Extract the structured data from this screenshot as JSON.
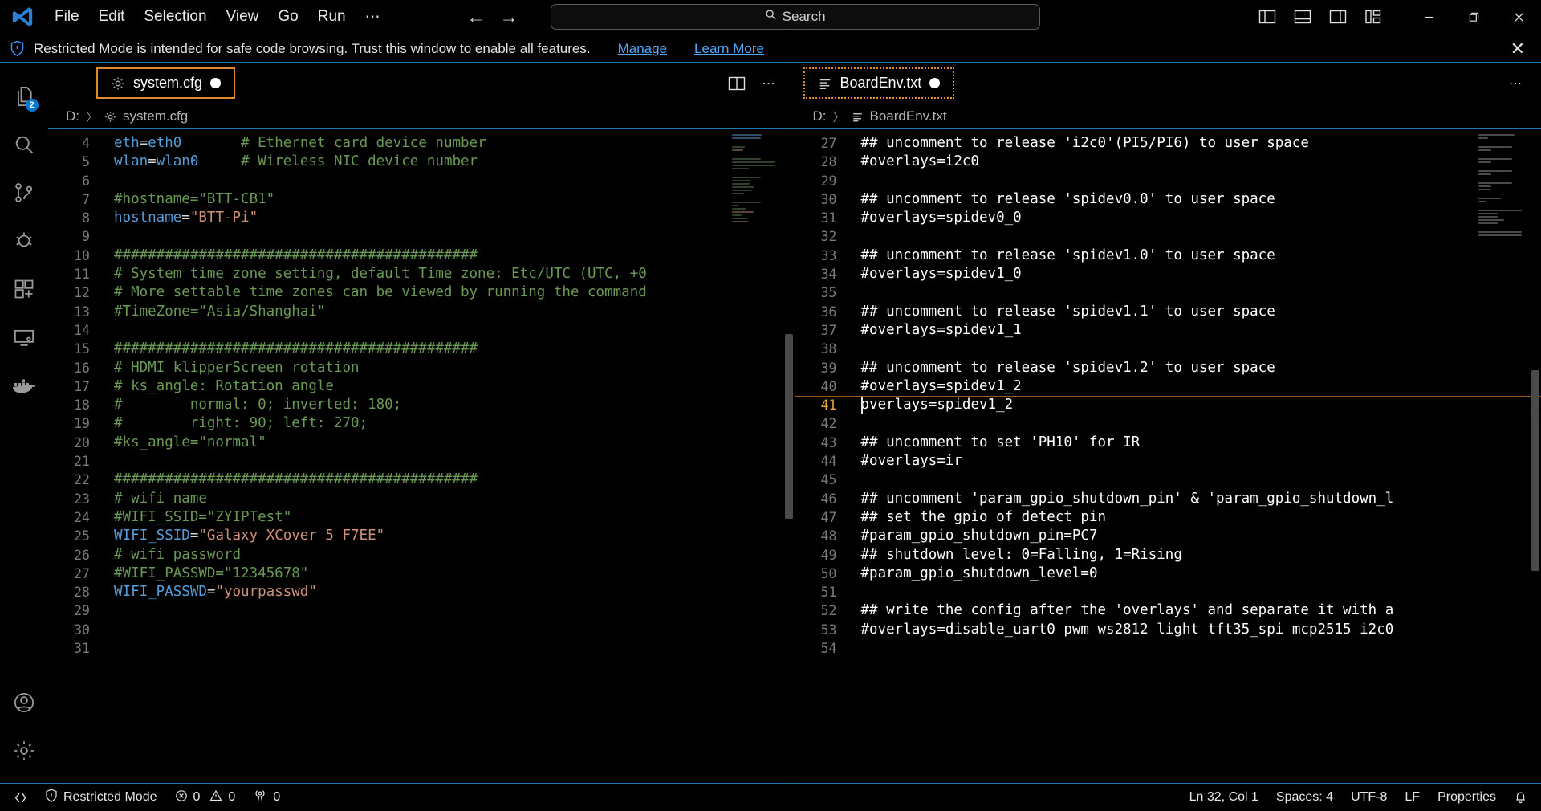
{
  "titlebar": {
    "logo_icon": "vscode-logo-icon",
    "menus": [
      "File",
      "Edit",
      "Selection",
      "View",
      "Go",
      "Run",
      "⋯"
    ],
    "nav_back_icon": "arrow-left-icon",
    "nav_forward_icon": "arrow-right-icon",
    "search": {
      "icon": "search-icon",
      "placeholder": "Search",
      "value": ""
    },
    "layout_icons": [
      "toggle-primary-sidebar-icon",
      "toggle-panel-icon",
      "toggle-secondary-sidebar-icon",
      "customize-layout-icon"
    ],
    "window": {
      "minimize_icon": "minimize-icon",
      "restore_icon": "restore-icon",
      "close_icon": "close-icon"
    }
  },
  "banner": {
    "icon": "shield-icon",
    "message": "Restricted Mode is intended for safe code browsing. Trust this window to enable all features.",
    "manage_link": "Manage",
    "learn_more_link": "Learn More",
    "close_icon": "close-icon"
  },
  "activitybar": {
    "items": [
      {
        "name": "explorer",
        "icon": "files-icon",
        "badge": "2"
      },
      {
        "name": "search",
        "icon": "search-icon",
        "badge": ""
      },
      {
        "name": "source-control",
        "icon": "source-control-icon",
        "badge": ""
      },
      {
        "name": "run-and-debug",
        "icon": "debug-icon",
        "badge": ""
      },
      {
        "name": "extensions",
        "icon": "extensions-icon",
        "badge": ""
      },
      {
        "name": "remote-explorer",
        "icon": "remote-explorer-icon",
        "badge": ""
      },
      {
        "name": "docker",
        "icon": "docker-icon",
        "badge": ""
      }
    ],
    "bottom": [
      {
        "name": "accounts",
        "icon": "account-icon"
      },
      {
        "name": "settings",
        "icon": "gear-icon"
      }
    ]
  },
  "editor_left": {
    "tab": {
      "label": "system.cfg",
      "icon": "gear-file-icon",
      "dirty": true,
      "focus_style": "solid-orange"
    },
    "breadcrumb": {
      "root": "D:",
      "separator": "〉",
      "file": "system.cfg",
      "icon": "gear-file-icon"
    },
    "actions": {
      "split_editor_icon": "split-editor-icon",
      "more_actions_icon": "more-actions-icon"
    },
    "lines": [
      {
        "n": "4",
        "tokens": [
          {
            "t": "key",
            "v": "eth"
          },
          {
            "t": "op",
            "v": "="
          },
          {
            "t": "key",
            "v": "eth0"
          },
          {
            "t": "plain",
            "v": "       "
          },
          {
            "t": "comment",
            "v": "# Ethernet card device number"
          }
        ]
      },
      {
        "n": "5",
        "tokens": [
          {
            "t": "key",
            "v": "wlan"
          },
          {
            "t": "op",
            "v": "="
          },
          {
            "t": "key",
            "v": "wlan0"
          },
          {
            "t": "plain",
            "v": "     "
          },
          {
            "t": "comment",
            "v": "# Wireless NIC device number"
          }
        ]
      },
      {
        "n": "6",
        "tokens": []
      },
      {
        "n": "7",
        "tokens": [
          {
            "t": "comment",
            "v": "#hostname=\"BTT-CB1\""
          }
        ]
      },
      {
        "n": "8",
        "tokens": [
          {
            "t": "key",
            "v": "hostname"
          },
          {
            "t": "op",
            "v": "="
          },
          {
            "t": "str",
            "v": "\"BTT-Pi\""
          }
        ]
      },
      {
        "n": "9",
        "tokens": []
      },
      {
        "n": "10",
        "tokens": [
          {
            "t": "comment",
            "v": "###########################################"
          }
        ]
      },
      {
        "n": "11",
        "tokens": [
          {
            "t": "comment",
            "v": "# System time zone setting, default Time zone: Etc/UTC (UTC, +0"
          }
        ]
      },
      {
        "n": "12",
        "tokens": [
          {
            "t": "comment",
            "v": "# More settable time zones can be viewed by running the command"
          }
        ]
      },
      {
        "n": "13",
        "tokens": [
          {
            "t": "comment",
            "v": "#TimeZone=\"Asia/Shanghai\""
          }
        ]
      },
      {
        "n": "14",
        "tokens": []
      },
      {
        "n": "15",
        "tokens": [
          {
            "t": "comment",
            "v": "###########################################"
          }
        ]
      },
      {
        "n": "16",
        "tokens": [
          {
            "t": "comment",
            "v": "# HDMI klipperScreen rotation"
          }
        ]
      },
      {
        "n": "17",
        "tokens": [
          {
            "t": "comment",
            "v": "# ks_angle: Rotation angle"
          }
        ]
      },
      {
        "n": "18",
        "tokens": [
          {
            "t": "comment",
            "v": "#        normal: 0; inverted: 180;"
          }
        ]
      },
      {
        "n": "19",
        "tokens": [
          {
            "t": "comment",
            "v": "#        right: 90; left: 270;"
          }
        ]
      },
      {
        "n": "20",
        "tokens": [
          {
            "t": "comment",
            "v": "#ks_angle=\"normal\""
          }
        ]
      },
      {
        "n": "21",
        "tokens": []
      },
      {
        "n": "22",
        "tokens": [
          {
            "t": "comment",
            "v": "###########################################"
          }
        ]
      },
      {
        "n": "23",
        "tokens": [
          {
            "t": "comment",
            "v": "# wifi name"
          }
        ]
      },
      {
        "n": "24",
        "tokens": [
          {
            "t": "comment",
            "v": "#WIFI_SSID=\"ZYIPTest\""
          }
        ]
      },
      {
        "n": "25",
        "tokens": [
          {
            "t": "key",
            "v": "WIFI_SSID"
          },
          {
            "t": "op",
            "v": "="
          },
          {
            "t": "str",
            "v": "\"Galaxy XCover 5 F7EE\""
          }
        ]
      },
      {
        "n": "26",
        "tokens": [
          {
            "t": "comment",
            "v": "# wifi password"
          }
        ]
      },
      {
        "n": "27",
        "tokens": [
          {
            "t": "comment",
            "v": "#WIFI_PASSWD=\"12345678\""
          }
        ]
      },
      {
        "n": "28",
        "tokens": [
          {
            "t": "key",
            "v": "WIFI_PASSWD"
          },
          {
            "t": "op",
            "v": "="
          },
          {
            "t": "str",
            "v": "\"yourpasswd\""
          }
        ]
      },
      {
        "n": "29",
        "tokens": []
      },
      {
        "n": "30",
        "tokens": []
      },
      {
        "n": "31",
        "tokens": []
      }
    ]
  },
  "editor_right": {
    "tab": {
      "label": "BoardEnv.txt",
      "icon": "text-file-icon",
      "dirty": true,
      "focus_style": "dotted-orange"
    },
    "breadcrumb": {
      "root": "D:",
      "separator": "〉",
      "file": "BoardEnv.txt",
      "icon": "text-file-icon"
    },
    "actions": {
      "more_actions_icon": "more-actions-icon"
    },
    "current_line": "41",
    "lines": [
      {
        "n": "27",
        "text": "## uncomment to release 'i2c0'(PI5/PI6) to user space"
      },
      {
        "n": "28",
        "text": "#overlays=i2c0"
      },
      {
        "n": "29",
        "text": ""
      },
      {
        "n": "30",
        "text": "## uncomment to release 'spidev0.0' to user space"
      },
      {
        "n": "31",
        "text": "#overlays=spidev0_0"
      },
      {
        "n": "32",
        "text": ""
      },
      {
        "n": "33",
        "text": "## uncomment to release 'spidev1.0' to user space"
      },
      {
        "n": "34",
        "text": "#overlays=spidev1_0"
      },
      {
        "n": "35",
        "text": ""
      },
      {
        "n": "36",
        "text": "## uncomment to release 'spidev1.1' to user space"
      },
      {
        "n": "37",
        "text": "#overlays=spidev1_1"
      },
      {
        "n": "38",
        "text": ""
      },
      {
        "n": "39",
        "text": "## uncomment to release 'spidev1.2' to user space"
      },
      {
        "n": "40",
        "text": "#overlays=spidev1_2"
      },
      {
        "n": "41",
        "text": "overlays=spidev1_2"
      },
      {
        "n": "42",
        "text": ""
      },
      {
        "n": "43",
        "text": "## uncomment to set 'PH10' for IR"
      },
      {
        "n": "44",
        "text": "#overlays=ir"
      },
      {
        "n": "45",
        "text": ""
      },
      {
        "n": "46",
        "text": "## uncomment 'param_gpio_shutdown_pin' & 'param_gpio_shutdown_l"
      },
      {
        "n": "47",
        "text": "## set the gpio of detect pin"
      },
      {
        "n": "48",
        "text": "#param_gpio_shutdown_pin=PC7"
      },
      {
        "n": "49",
        "text": "## shutdown level: 0=Falling, 1=Rising"
      },
      {
        "n": "50",
        "text": "#param_gpio_shutdown_level=0"
      },
      {
        "n": "51",
        "text": ""
      },
      {
        "n": "52",
        "text": "## write the config after the 'overlays' and separate it with a"
      },
      {
        "n": "53",
        "text": "#overlays=disable_uart0 pwm ws2812 light tft35_spi mcp2515 i2c0"
      },
      {
        "n": "54",
        "text": ""
      }
    ]
  },
  "statusbar": {
    "remote_icon": "remote-window-icon",
    "restricted_icon": "shield-icon",
    "restricted_label": "Restricted Mode",
    "errors_icon": "error-icon",
    "errors": "0",
    "warnings_icon": "warning-icon",
    "warnings": "0",
    "ports_icon": "radio-tower-icon",
    "ports": "0",
    "cursor_position": "Ln 32, Col 1",
    "indentation": "Spaces: 4",
    "encoding": "UTF-8",
    "eol": "LF",
    "language": "Properties",
    "bell_icon": "bell-icon"
  },
  "colors": {
    "accent_border": "#1d7ab5",
    "tab_focus": "#e08a2e",
    "comment": "#6a9955",
    "keyword": "#569cd6",
    "string": "#ce9178",
    "badge": "#0078d4",
    "link": "#4daafc"
  }
}
